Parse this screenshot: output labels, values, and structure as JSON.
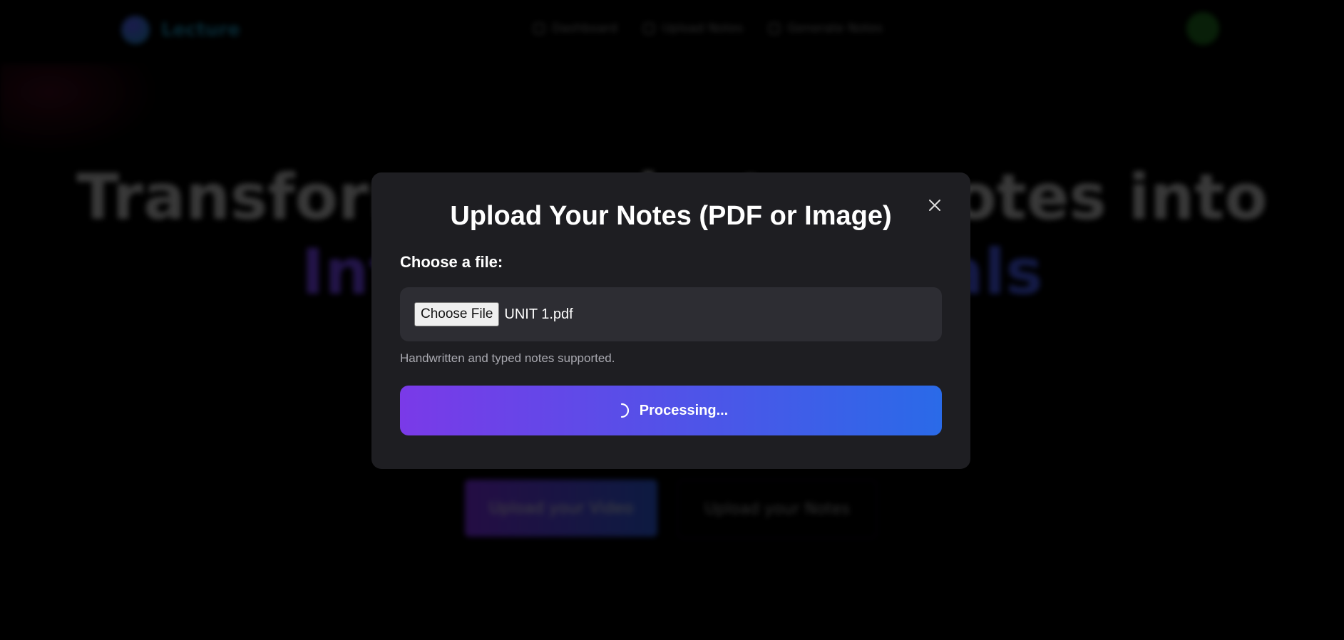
{
  "background": {
    "logo_text": "Lecture",
    "nav": [
      "Dashboard",
      "Upload Notes",
      "Generate Notes"
    ],
    "hero_line1": "Transform your lecture notes into",
    "hero_line2": "Interactive materials",
    "subtitle_line1": "",
    "subtitle_line2": "",
    "cta_video": "Upload your Video",
    "cta_notes": "Upload your Notes",
    "colors": {
      "accent_start": "#7a3ae8",
      "accent_end": "#2a6ae8"
    }
  },
  "modal": {
    "title": "Upload Your Notes (PDF or Image)",
    "close_icon": "close-icon",
    "file_label": "Choose a file:",
    "choose_button": "Choose File",
    "file_name": "UNIT 1.pdf",
    "hint": "Handwritten and typed notes supported.",
    "process_button": "Processing...",
    "spinner_icon": "spinner-icon"
  }
}
